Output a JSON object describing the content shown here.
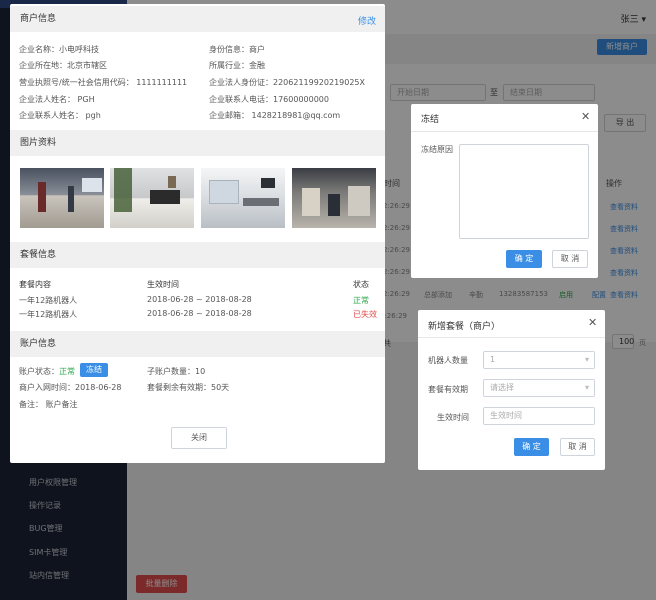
{
  "topbar": {
    "user": "张三 ▾"
  },
  "sidebar": {
    "items": [
      "用户权限管理",
      "操作记录",
      "BUG管理",
      "SIM卡管理",
      "站内信管理"
    ]
  },
  "background": {
    "add_merchant": "新增商户",
    "start_date": "开始日期",
    "to": "至",
    "end_date": "结束日期",
    "export": "导 出",
    "col_time": "时间",
    "col_ops": "操作",
    "row_times": [
      "2:26:29",
      "2:26:29",
      "2:26:29",
      "2:26:29",
      "2:26:29",
      "2:26:29"
    ],
    "row_ops": [
      "查看资料",
      "查看资料",
      "查看资料",
      "查看资料",
      "查看资料"
    ],
    "row_extra": {
      "source": "总部添加",
      "person": "辛勤",
      "phone": "13283587153",
      "status": "启用",
      "action": "配置"
    },
    "pager_total": "共",
    "pager_size": "100",
    "pager_unit": "页",
    "batch_delete": "批量删除"
  },
  "merchant": {
    "title": "商户信息",
    "edit": "修改",
    "info": {
      "name": "企业名称：小电呼科技",
      "identity": "身份信息：商户",
      "location": "企业所在地：北京市辖区",
      "industry": "所属行业：金融",
      "license": "营业执照号/统一社会信用代码： 1111111111",
      "legal_id": "企业法人身份证：22062119920219025X",
      "legal_name": "企业法人姓名：  PGH",
      "contact_phone": "企业联系人电话：17600000000",
      "contact_name": "企业联系人姓名：  pgh",
      "email": "企业邮箱：  1428218981@qq.com"
    },
    "photos_title": "图片资料",
    "package_title": "套餐信息",
    "package_cols": {
      "content": "套餐内容",
      "time": "生效时间",
      "status": "状态"
    },
    "packages": [
      {
        "content": "一年12路机器人",
        "time": "2018-06-28 ~ 2018-08-28",
        "status": "正常"
      },
      {
        "content": "一年12路机器人",
        "time": "2018-06-28 ~ 2018-08-28",
        "status": "已失效"
      }
    ],
    "account_title": "账户信息",
    "account": {
      "status_label": "账户状态：",
      "status_value": "正常",
      "freeze_btn": "冻结",
      "sub_count": "子账户数量：10",
      "join_time": "商户入网时间：2018-06-28",
      "remain": "套餐剩余有效期：50天",
      "remark": "备注：  账户备注"
    },
    "close": "关闭"
  },
  "freeze_dialog": {
    "title": "冻结",
    "reason_label": "冻结原因",
    "confirm": "确 定",
    "cancel": "取 消"
  },
  "package_dialog": {
    "title": "新增套餐（商户）",
    "robot_label": "机器人数量",
    "robot_value": "1",
    "period_label": "套餐有效期",
    "period_placeholder": "请选择",
    "effective_label": "生效时间",
    "effective_placeholder": "生效时间",
    "confirm": "确 定",
    "cancel": "取 消"
  },
  "colors": {
    "sidebar": "#1d2436",
    "primary": "#3a8ee6",
    "danger": "#e04b4b",
    "success": "#2aa84a"
  }
}
